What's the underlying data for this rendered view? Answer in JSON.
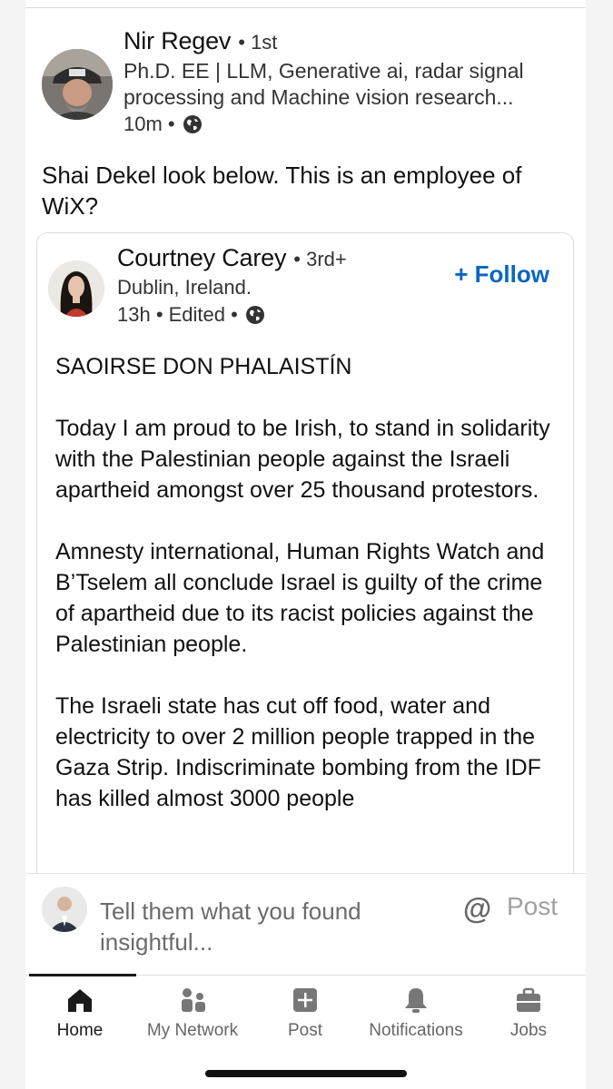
{
  "sharer": {
    "name": "Nir Regev",
    "degree": "• 1st",
    "headline": "Ph.D. EE | LLM, Generative ai, radar signal processing and Machine vision research...",
    "time": "10m •",
    "visibility_icon": "globe-icon"
  },
  "share_text": "Shai Dekel look below. This is an employee of WiX?",
  "original_post": {
    "author": {
      "name": "Courtney Carey",
      "degree": "• 3rd+",
      "location": "Dublin, Ireland.",
      "time": "13h • Edited •"
    },
    "follow_label": "+ Follow",
    "paragraphs": [
      "SAOIRSE DON PHALAISTÍN",
      "Today I am proud to be Irish, to stand in solidarity with the Palestinian people against the Israeli apartheid amongst over 25 thousand protestors.",
      "Amnesty international, Human Rights Watch and B’Tselem all conclude Israel is guilty of the crime of apartheid due to its racist policies against the Palestinian people.",
      "The Israeli state has cut off food, water and electricity to over 2 million people trapped in the Gaza Strip. Indiscriminate bombing from the IDF has killed almost 3000 people"
    ]
  },
  "composer": {
    "placeholder": "Tell them what you found insightful...",
    "mention_icon": "@",
    "post_label": "Post"
  },
  "nav": {
    "items": [
      {
        "label": "Home",
        "icon": "home-icon",
        "active": true
      },
      {
        "label": "My Network",
        "icon": "network-icon",
        "active": false
      },
      {
        "label": "Post",
        "icon": "post-icon",
        "active": false
      },
      {
        "label": "Notifications",
        "icon": "bell-icon",
        "active": false
      },
      {
        "label": "Jobs",
        "icon": "briefcase-icon",
        "active": false
      }
    ]
  },
  "colors": {
    "accent": "#0a66c2",
    "text": "#111111",
    "muted": "#666666"
  }
}
